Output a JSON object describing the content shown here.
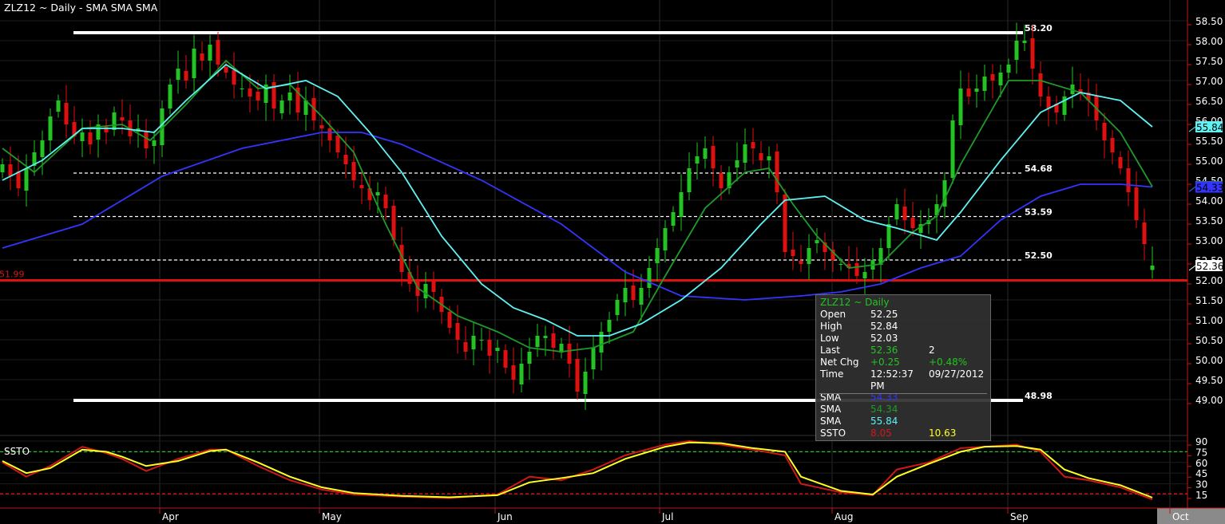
{
  "header": {
    "title": "ZLZ12 ~ Daily  -  SMA SMA SMA"
  },
  "colors": {
    "up": "#22c322",
    "down": "#e01010",
    "sma_blue": "#3434ff",
    "sma_green": "#1f9a2a",
    "sma_cyan": "#5ff2f2",
    "ssto_red": "#d01818",
    "ssto_yellow": "#ffff20",
    "axis": "#c01818"
  },
  "chart_data": [
    {
      "type": "candlestick",
      "title": "ZLZ12 ~ Daily",
      "ylim": [
        48.8,
        58.6
      ],
      "y_ticks": [
        "58.50",
        "58.00",
        "57.50",
        "57.00",
        "56.50",
        "56.00",
        "55.50",
        "55.00",
        "54.50",
        "54.00",
        "53.50",
        "53.00",
        "52.50",
        "52.00",
        "51.50",
        "51.00",
        "50.50",
        "50.00",
        "49.50",
        "49.00"
      ],
      "months": [
        {
          "label": "Apr",
          "day": 19.7
        },
        {
          "label": "May",
          "day": 39.7
        },
        {
          "label": "Jun",
          "day": 61.7
        },
        {
          "label": "Jul",
          "day": 82.3
        },
        {
          "label": "Aug",
          "day": 103.9
        },
        {
          "label": "Sep",
          "day": 125.9
        },
        {
          "label": "Oct",
          "day": 146.2
        }
      ],
      "closes": [
        54.9,
        54.6,
        54.3,
        54.8,
        55.2,
        55.5,
        56.1,
        56.5,
        55.9,
        55.6,
        55.7,
        55.4,
        55.9,
        55.7,
        56.2,
        56.0,
        55.6,
        55.8,
        55.3,
        55.5,
        56.3,
        56.9,
        57.3,
        57.0,
        57.8,
        57.5,
        57.9,
        57.4,
        57.2,
        56.9,
        56.8,
        56.6,
        56.5,
        56.9,
        56.3,
        56.5,
        56.7,
        56.2,
        56.5,
        56.0,
        55.8,
        55.5,
        55.2,
        54.9,
        54.5,
        54.3,
        54.0,
        54.2,
        53.8,
        53.0,
        52.2,
        51.9,
        51.6,
        51.9,
        51.7,
        51.2,
        50.8,
        50.5,
        50.2,
        50.6,
        50.5,
        50.1,
        50.3,
        49.8,
        49.5,
        49.9,
        50.2,
        50.6,
        50.6,
        50.3,
        50.4,
        49.9,
        49.2,
        49.7,
        50.3,
        50.7,
        51.0,
        51.5,
        51.8,
        51.5,
        51.8,
        52.3,
        52.8,
        53.3,
        53.7,
        54.2,
        54.8,
        55.1,
        55.3,
        54.8,
        54.3,
        54.7,
        55.0,
        55.4,
        55.3,
        55.0,
        55.1,
        54.2,
        52.7,
        52.6,
        52.4,
        52.8,
        53.0,
        52.7,
        52.5,
        52.4,
        52.3,
        52.1,
        52.2,
        52.5,
        52.8,
        53.4,
        53.9,
        53.5,
        53.3,
        53.4,
        53.5,
        53.9,
        54.5,
        56.0,
        56.8,
        56.6,
        56.8,
        57.1,
        57.0,
        57.2,
        57.4,
        58.0,
        58.0,
        57.3,
        56.6,
        56.3,
        56.2,
        56.6,
        56.9,
        56.7,
        56.5,
        56.0,
        55.5,
        55.2,
        54.8,
        54.2,
        53.5,
        52.9
      ],
      "last_bar": {
        "open": 52.25,
        "high": 52.84,
        "low": 52.03,
        "close": 52.36
      },
      "sma": [
        {
          "name": "SMA",
          "color_key": "sma_blue",
          "last": "54.33",
          "points": [
            [
              0,
              52.8
            ],
            [
              10,
              53.4
            ],
            [
              20,
              54.6
            ],
            [
              30,
              55.3
            ],
            [
              40,
              55.7
            ],
            [
              45,
              55.7
            ],
            [
              50,
              55.4
            ],
            [
              60,
              54.5
            ],
            [
              70,
              53.4
            ],
            [
              78,
              52.2
            ],
            [
              85,
              51.6
            ],
            [
              93,
              51.5
            ],
            [
              100,
              51.6
            ],
            [
              105,
              51.7
            ],
            [
              110,
              51.9
            ],
            [
              115,
              52.3
            ],
            [
              120,
              52.6
            ],
            [
              125,
              53.5
            ],
            [
              130,
              54.1
            ],
            [
              135,
              54.4
            ],
            [
              140,
              54.4
            ],
            [
              144,
              54.33
            ]
          ]
        },
        {
          "name": "SMA",
          "color_key": "sma_green",
          "last": "54.34",
          "points": [
            [
              0,
              55.3
            ],
            [
              4,
              54.7
            ],
            [
              10,
              55.8
            ],
            [
              15,
              55.9
            ],
            [
              18.5,
              55.5
            ],
            [
              23,
              56.4
            ],
            [
              28,
              57.5
            ],
            [
              32,
              56.8
            ],
            [
              36,
              56.9
            ],
            [
              40,
              56.1
            ],
            [
              44,
              55.2
            ],
            [
              48,
              53.4
            ],
            [
              52,
              51.8
            ],
            [
              57,
              51.1
            ],
            [
              62,
              50.7
            ],
            [
              66,
              50.3
            ],
            [
              70,
              50.2
            ],
            [
              74,
              50.3
            ],
            [
              79,
              50.7
            ],
            [
              83,
              52.1
            ],
            [
              88,
              53.8
            ],
            [
              93,
              54.7
            ],
            [
              96,
              54.8
            ],
            [
              99,
              53.9
            ],
            [
              102,
              53.1
            ],
            [
              106,
              52.3
            ],
            [
              110,
              52.4
            ],
            [
              114,
              53.2
            ],
            [
              117,
              53.6
            ],
            [
              120,
              54.9
            ],
            [
              126,
              57.0
            ],
            [
              130,
              57.0
            ],
            [
              135,
              56.7
            ],
            [
              140,
              55.7
            ],
            [
              144,
              54.34
            ]
          ]
        },
        {
          "name": "SMA",
          "color_key": "sma_cyan",
          "last": "55.84",
          "points": [
            [
              0,
              54.5
            ],
            [
              5,
              55.0
            ],
            [
              10,
              55.8
            ],
            [
              15,
              55.8
            ],
            [
              19,
              55.7
            ],
            [
              23,
              56.5
            ],
            [
              28,
              57.4
            ],
            [
              33,
              56.8
            ],
            [
              38,
              57.0
            ],
            [
              42,
              56.6
            ],
            [
              46,
              55.7
            ],
            [
              50,
              54.7
            ],
            [
              55,
              53.1
            ],
            [
              60,
              51.9
            ],
            [
              64,
              51.3
            ],
            [
              68,
              51.0
            ],
            [
              72,
              50.6
            ],
            [
              76,
              50.6
            ],
            [
              80,
              50.9
            ],
            [
              85,
              51.5
            ],
            [
              90,
              52.3
            ],
            [
              95,
              53.4
            ],
            [
              98,
              54.0
            ],
            [
              103,
              54.1
            ],
            [
              108,
              53.5
            ],
            [
              112,
              53.3
            ],
            [
              117,
              53.0
            ],
            [
              120,
              53.7
            ],
            [
              125,
              55.0
            ],
            [
              130,
              56.2
            ],
            [
              135,
              56.7
            ],
            [
              140,
              56.5
            ],
            [
              144,
              55.84
            ]
          ]
        }
      ],
      "levels": [
        {
          "value": 58.2,
          "label": "58.20",
          "style": "solid-white"
        },
        {
          "value": 54.68,
          "label": "54.68",
          "style": "dashed-white"
        },
        {
          "value": 53.59,
          "label": "53.59",
          "style": "dashed-white"
        },
        {
          "value": 52.5,
          "label": "52.50",
          "style": "dashed-white"
        },
        {
          "value": 48.98,
          "label": "48.98",
          "style": "solid-white"
        },
        {
          "value": 51.99,
          "label": "51.99",
          "style": "solid-red"
        }
      ],
      "last_price_label": "52.36"
    },
    {
      "type": "line",
      "title": "SSTO",
      "ylim": [
        5,
        95
      ],
      "y_ticks": [
        "90",
        "75",
        "60",
        "45",
        "30",
        "15"
      ],
      "levels": [
        {
          "value": 75,
          "color_key": "up"
        },
        {
          "value": 16,
          "color_key": "down"
        }
      ],
      "series": [
        {
          "name": "SSTO %K",
          "color_key": "ssto_red",
          "points": [
            [
              0,
              60
            ],
            [
              3,
              40
            ],
            [
              6,
              55
            ],
            [
              10,
              82
            ],
            [
              13,
              73
            ],
            [
              15,
              65
            ],
            [
              18,
              48
            ],
            [
              22,
              65
            ],
            [
              26,
              78
            ],
            [
              28,
              78
            ],
            [
              32,
              55
            ],
            [
              36,
              35
            ],
            [
              40,
              22
            ],
            [
              44,
              15
            ],
            [
              50,
              12
            ],
            [
              56,
              10
            ],
            [
              62,
              15
            ],
            [
              66,
              40
            ],
            [
              70,
              35
            ],
            [
              74,
              50
            ],
            [
              78,
              70
            ],
            [
              83,
              85
            ],
            [
              86,
              90
            ],
            [
              90,
              85
            ],
            [
              94,
              78
            ],
            [
              98,
              70
            ],
            [
              100,
              30
            ],
            [
              105,
              18
            ],
            [
              109,
              14
            ],
            [
              112,
              50
            ],
            [
              116,
              60
            ],
            [
              120,
              80
            ],
            [
              123,
              82
            ],
            [
              127,
              85
            ],
            [
              130,
              75
            ],
            [
              133,
              40
            ],
            [
              136,
              35
            ],
            [
              140,
              25
            ],
            [
              144,
              8.05
            ]
          ]
        },
        {
          "name": "SSTO %D",
          "color_key": "ssto_yellow",
          "points": [
            [
              0,
              62
            ],
            [
              3,
              45
            ],
            [
              6,
              52
            ],
            [
              10,
              78
            ],
            [
              13,
              75
            ],
            [
              15,
              68
            ],
            [
              18,
              55
            ],
            [
              22,
              62
            ],
            [
              26,
              76
            ],
            [
              28,
              78
            ],
            [
              32,
              60
            ],
            [
              36,
              40
            ],
            [
              40,
              25
            ],
            [
              44,
              17
            ],
            [
              50,
              13
            ],
            [
              56,
              11
            ],
            [
              62,
              14
            ],
            [
              66,
              32
            ],
            [
              70,
              38
            ],
            [
              74,
              45
            ],
            [
              78,
              65
            ],
            [
              83,
              82
            ],
            [
              86,
              88
            ],
            [
              90,
              87
            ],
            [
              94,
              80
            ],
            [
              98,
              75
            ],
            [
              100,
              40
            ],
            [
              105,
              20
            ],
            [
              109,
              15
            ],
            [
              112,
              40
            ],
            [
              116,
              58
            ],
            [
              120,
              75
            ],
            [
              123,
              82
            ],
            [
              127,
              83
            ],
            [
              130,
              78
            ],
            [
              133,
              50
            ],
            [
              136,
              38
            ],
            [
              140,
              28
            ],
            [
              144,
              10.63
            ]
          ]
        }
      ]
    }
  ],
  "tooltip": {
    "title": "ZLZ12 ~ Daily",
    "rows": [
      {
        "label": "Open",
        "v1": "52.25",
        "v2": ""
      },
      {
        "label": "High",
        "v1": "52.84",
        "v2": ""
      },
      {
        "label": "Low",
        "v1": "52.03",
        "v2": ""
      },
      {
        "label": "Last",
        "v1": "52.36",
        "v2": "2"
      },
      {
        "label": "Net Chg",
        "v1": "+0.25",
        "v2": "+0.48%"
      },
      {
        "label": "Time",
        "v1": "12:52:37 PM",
        "v2": "09/27/2012"
      }
    ],
    "studies": [
      {
        "label": "SMA",
        "v1": "54.33",
        "v2": ""
      },
      {
        "label": "SMA",
        "v1": "54.34",
        "v2": ""
      },
      {
        "label": "SMA",
        "v1": "55.84",
        "v2": ""
      },
      {
        "label": "SSTO",
        "v1": "8.05",
        "v2": "10.63"
      }
    ]
  }
}
